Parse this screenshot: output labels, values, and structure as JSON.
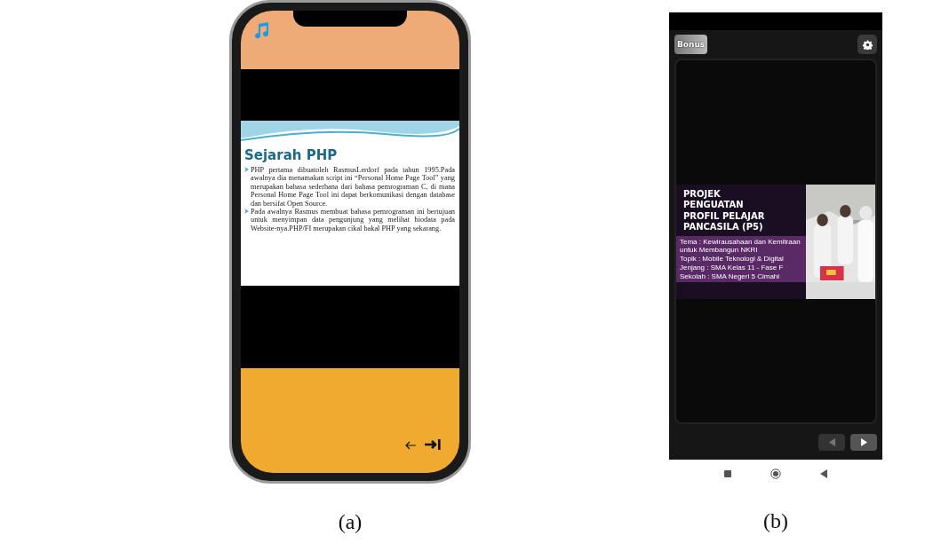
{
  "phone_a": {
    "slide": {
      "title": "Sejarah PHP",
      "bullets": [
        "PHP pertama dibuatoleh RasmusLerdorf pada tahun 1995.Pada awalnya dia menamakan script ini “Personal Home Page Tool” yang merupakan bahasa sederhana dari bahasa pemrograman C, di mana Personal Home Page Tool ini dapat berkomunikasi dengan database dan bersifat Open Source.",
        "Pada awalnya Rasmus membuat bahasa pemrograman ini bertujuan untuk menyimpan data pengunjung yang melihat biodata pada Website-nya.PHP/FI merupakan cikal bakal PHP yang sekarang."
      ]
    }
  },
  "phone_b": {
    "bonus_button": "Bonus",
    "slide": {
      "title_lines": [
        "PROJEK",
        "PENGUATAN",
        "PROFIL PELAJAR",
        "PANCASILA (P5)"
      ],
      "details": [
        "Tema : Kewirausahaan dan Kemitraan untuk Membangun NKRI",
        "Topik : Mobile Teknologi & Digital",
        "Jenjang : SMA Kelas 11 - Fase F",
        "Sekolah : SMA Negeri 5 Cimahi"
      ]
    },
    "nav_buttons": [
      {
        "kind": "prev",
        "disabled": true
      },
      {
        "kind": "next",
        "disabled": false
      }
    ]
  },
  "captions": [
    "(a)",
    "(b)"
  ]
}
